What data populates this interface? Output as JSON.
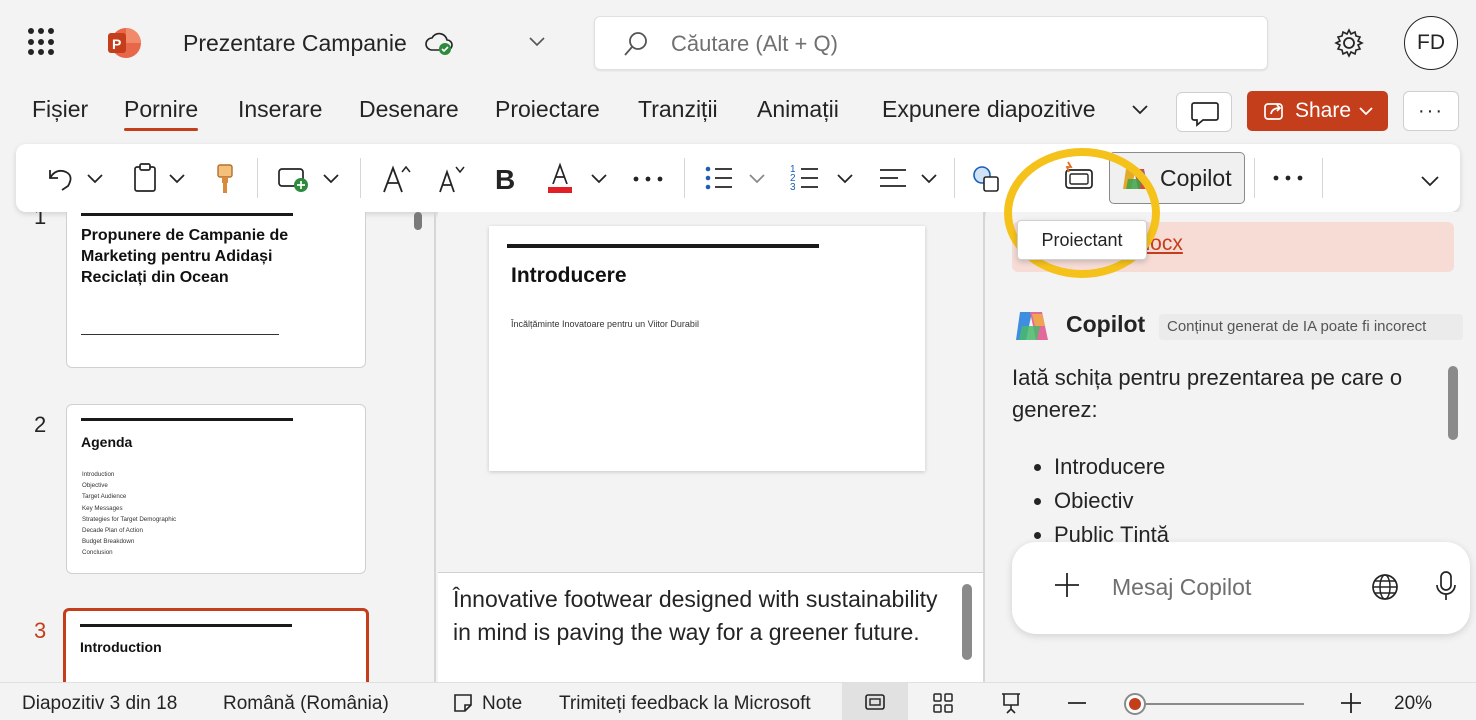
{
  "app": {
    "title": "Prezentare Campanie",
    "search_placeholder": "Căutare (Alt + Q)",
    "avatar_initials": "FD",
    "accent_color": "#c43e1c"
  },
  "tabs": [
    "Fișier",
    "Pornire",
    "Inserare",
    "Desenare",
    "Proiectare",
    "Tranziții",
    "Animații",
    "Expunere diapozitive"
  ],
  "active_tab": "Pornire",
  "header": {
    "share_label": "Share",
    "more_label": "···"
  },
  "ribbon": {
    "copilot_label": "Copilot",
    "more_label": "···",
    "designer_tooltip": "Proiectant",
    "icons": [
      "undo-icon",
      "clipboard-icon",
      "format-painter-icon",
      "new-slide-icon",
      "grow-font-icon",
      "shrink-font-icon",
      "bold-icon",
      "font-color-icon",
      "bullets-icon",
      "numbering-icon",
      "align-icon",
      "shapes-icon",
      "designer-icon",
      "copilot-icon"
    ]
  },
  "thumbnails": [
    {
      "num": "1",
      "title": "Propunere de Campanie de Marketing pentru Adidași Reciclați din Ocean"
    },
    {
      "num": "2",
      "title": "Agenda",
      "items": [
        "Introduction",
        "Objective",
        "Target Audience",
        "Key Messages",
        "Strategies for Target Demographic",
        "Decade Plan of Action",
        "Budget Breakdown",
        "Conclusion"
      ]
    },
    {
      "num": "3",
      "title": "Introduction"
    }
  ],
  "slide": {
    "title": "Introducere",
    "subtitle": "Încălțăminte Inovatoare pentru un Viitor Durabil"
  },
  "notes": "Înnovative footwear designed with sustainability in mind is paving the way for a greener future.",
  "copilot": {
    "doc_link": "i.docx",
    "name": "Copilot",
    "disclaimer": "Conținut generat de IA poate fi incorect",
    "message": "Iată schița pentru prezentarea pe care o generez:",
    "list": [
      "Introducere",
      "Obiectiv",
      "Public Țintă"
    ],
    "composer_placeholder": "Mesaj Copilot"
  },
  "status": {
    "slide_counter": "Diapozitiv 3 din 18",
    "language": "Română (România)",
    "notes_label": "Note",
    "feedback_label": "Trimiteți feedback la Microsoft",
    "zoom": "20%"
  }
}
